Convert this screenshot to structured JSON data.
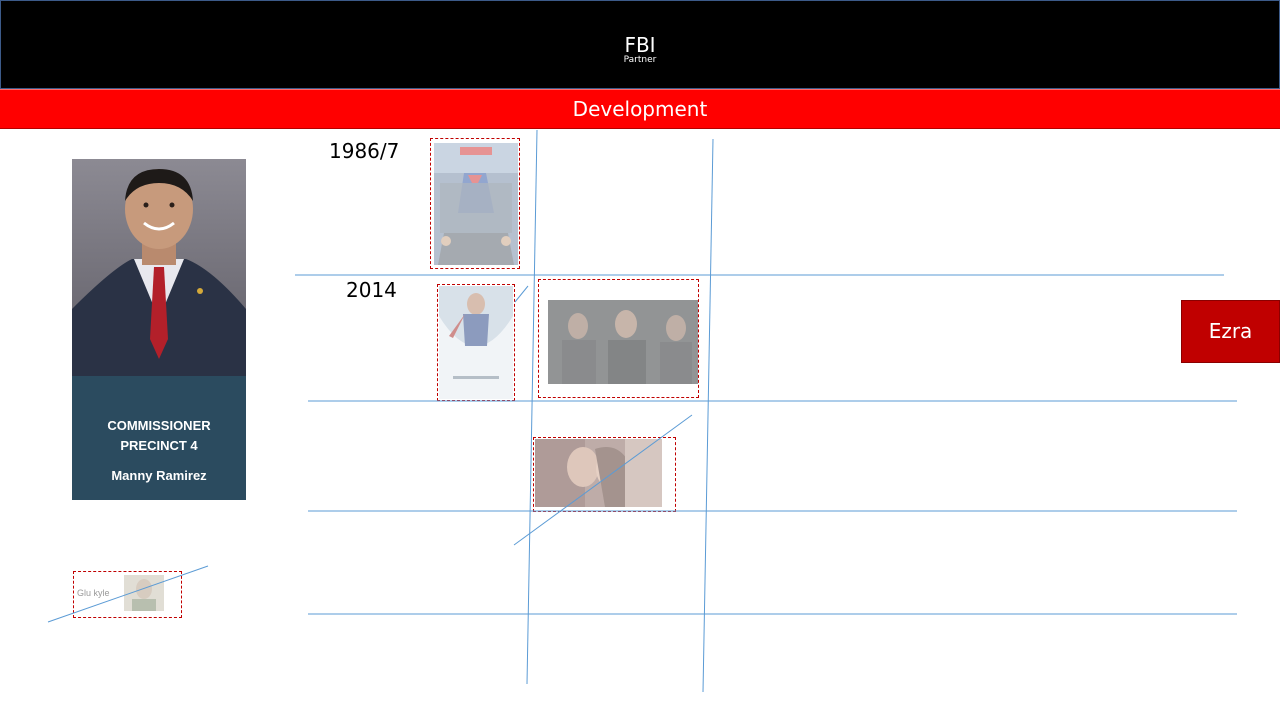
{
  "header": {
    "title": "FBI",
    "subtitle": "Partner"
  },
  "banner": {
    "label": "Development"
  },
  "profile": {
    "role_line1": "COMMISSIONER",
    "role_line2": "PRECINCT 4",
    "name": "Manny Ramirez"
  },
  "timeline": {
    "year1": "1986/7",
    "year2": "2014"
  },
  "ezra": {
    "label": "Ezra"
  },
  "crossed_item": {
    "label": "Glu kyle"
  },
  "colors": {
    "header_bg": "#000000",
    "banner_bg": "#ff0000",
    "caption_bg": "#2b4b5f",
    "ezra_bg": "#c00000",
    "grid_line": "#5b9bd5"
  }
}
